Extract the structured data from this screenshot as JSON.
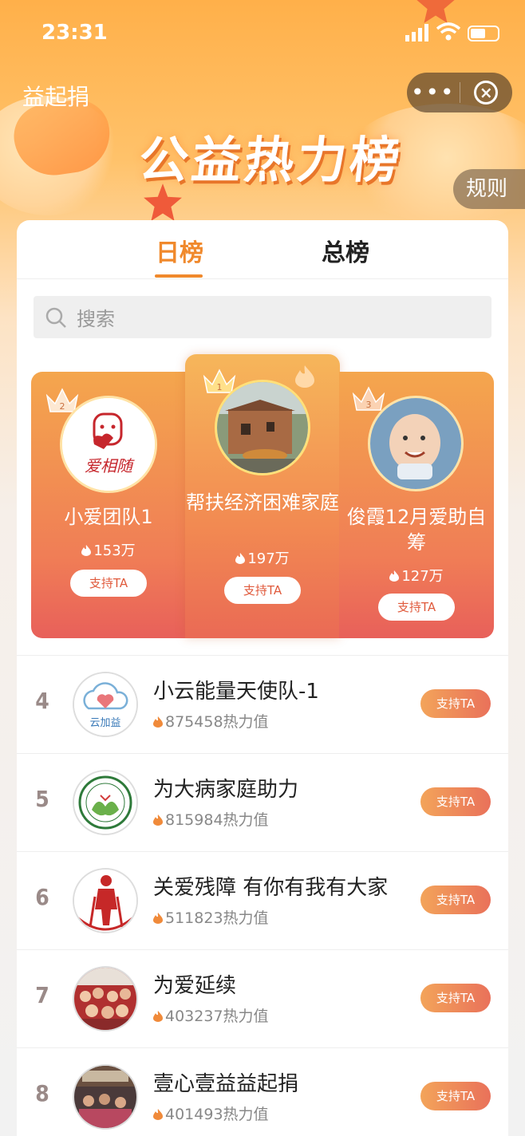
{
  "status_bar": {
    "time": "23:31"
  },
  "nav": {
    "app_title": "益起捐",
    "more_label": "•••",
    "close_label": "×"
  },
  "banner": {
    "title": "公益热力榜",
    "rules_label": "规则"
  },
  "tabs": [
    {
      "label": "日榜",
      "active": true
    },
    {
      "label": "总榜",
      "active": false
    }
  ],
  "search": {
    "placeholder": "搜索"
  },
  "podium": [
    {
      "rank": "1",
      "name": "帮扶经济困难家庭",
      "heat": "197万",
      "button": "支持TA"
    },
    {
      "rank": "2",
      "name": "小爱团队1",
      "heat": "153万",
      "button": "支持TA",
      "logo_text": "爱相随"
    },
    {
      "rank": "3",
      "name": "俊霞12月爱助自筹",
      "heat": "127万",
      "button": "支持TA"
    }
  ],
  "list": [
    {
      "rank": "4",
      "name": "小云能量天使队-1",
      "heat": "875458热力值",
      "button": "支持TA",
      "logo_text": "云加益"
    },
    {
      "rank": "5",
      "name": "为大病家庭助力",
      "heat": "815984热力值",
      "button": "支持TA"
    },
    {
      "rank": "6",
      "name": "关爱残障 有你有我有大家",
      "heat": "511823热力值",
      "button": "支持TA"
    },
    {
      "rank": "7",
      "name": "为爱延续",
      "heat": "403237热力值",
      "button": "支持TA"
    },
    {
      "rank": "8",
      "name": "壹心壹益益起捐",
      "heat": "401493热力值",
      "button": "支持TA"
    }
  ],
  "colors": {
    "accent": "#f0892c",
    "button_start": "#f3a45a",
    "button_end": "#e9715a"
  }
}
